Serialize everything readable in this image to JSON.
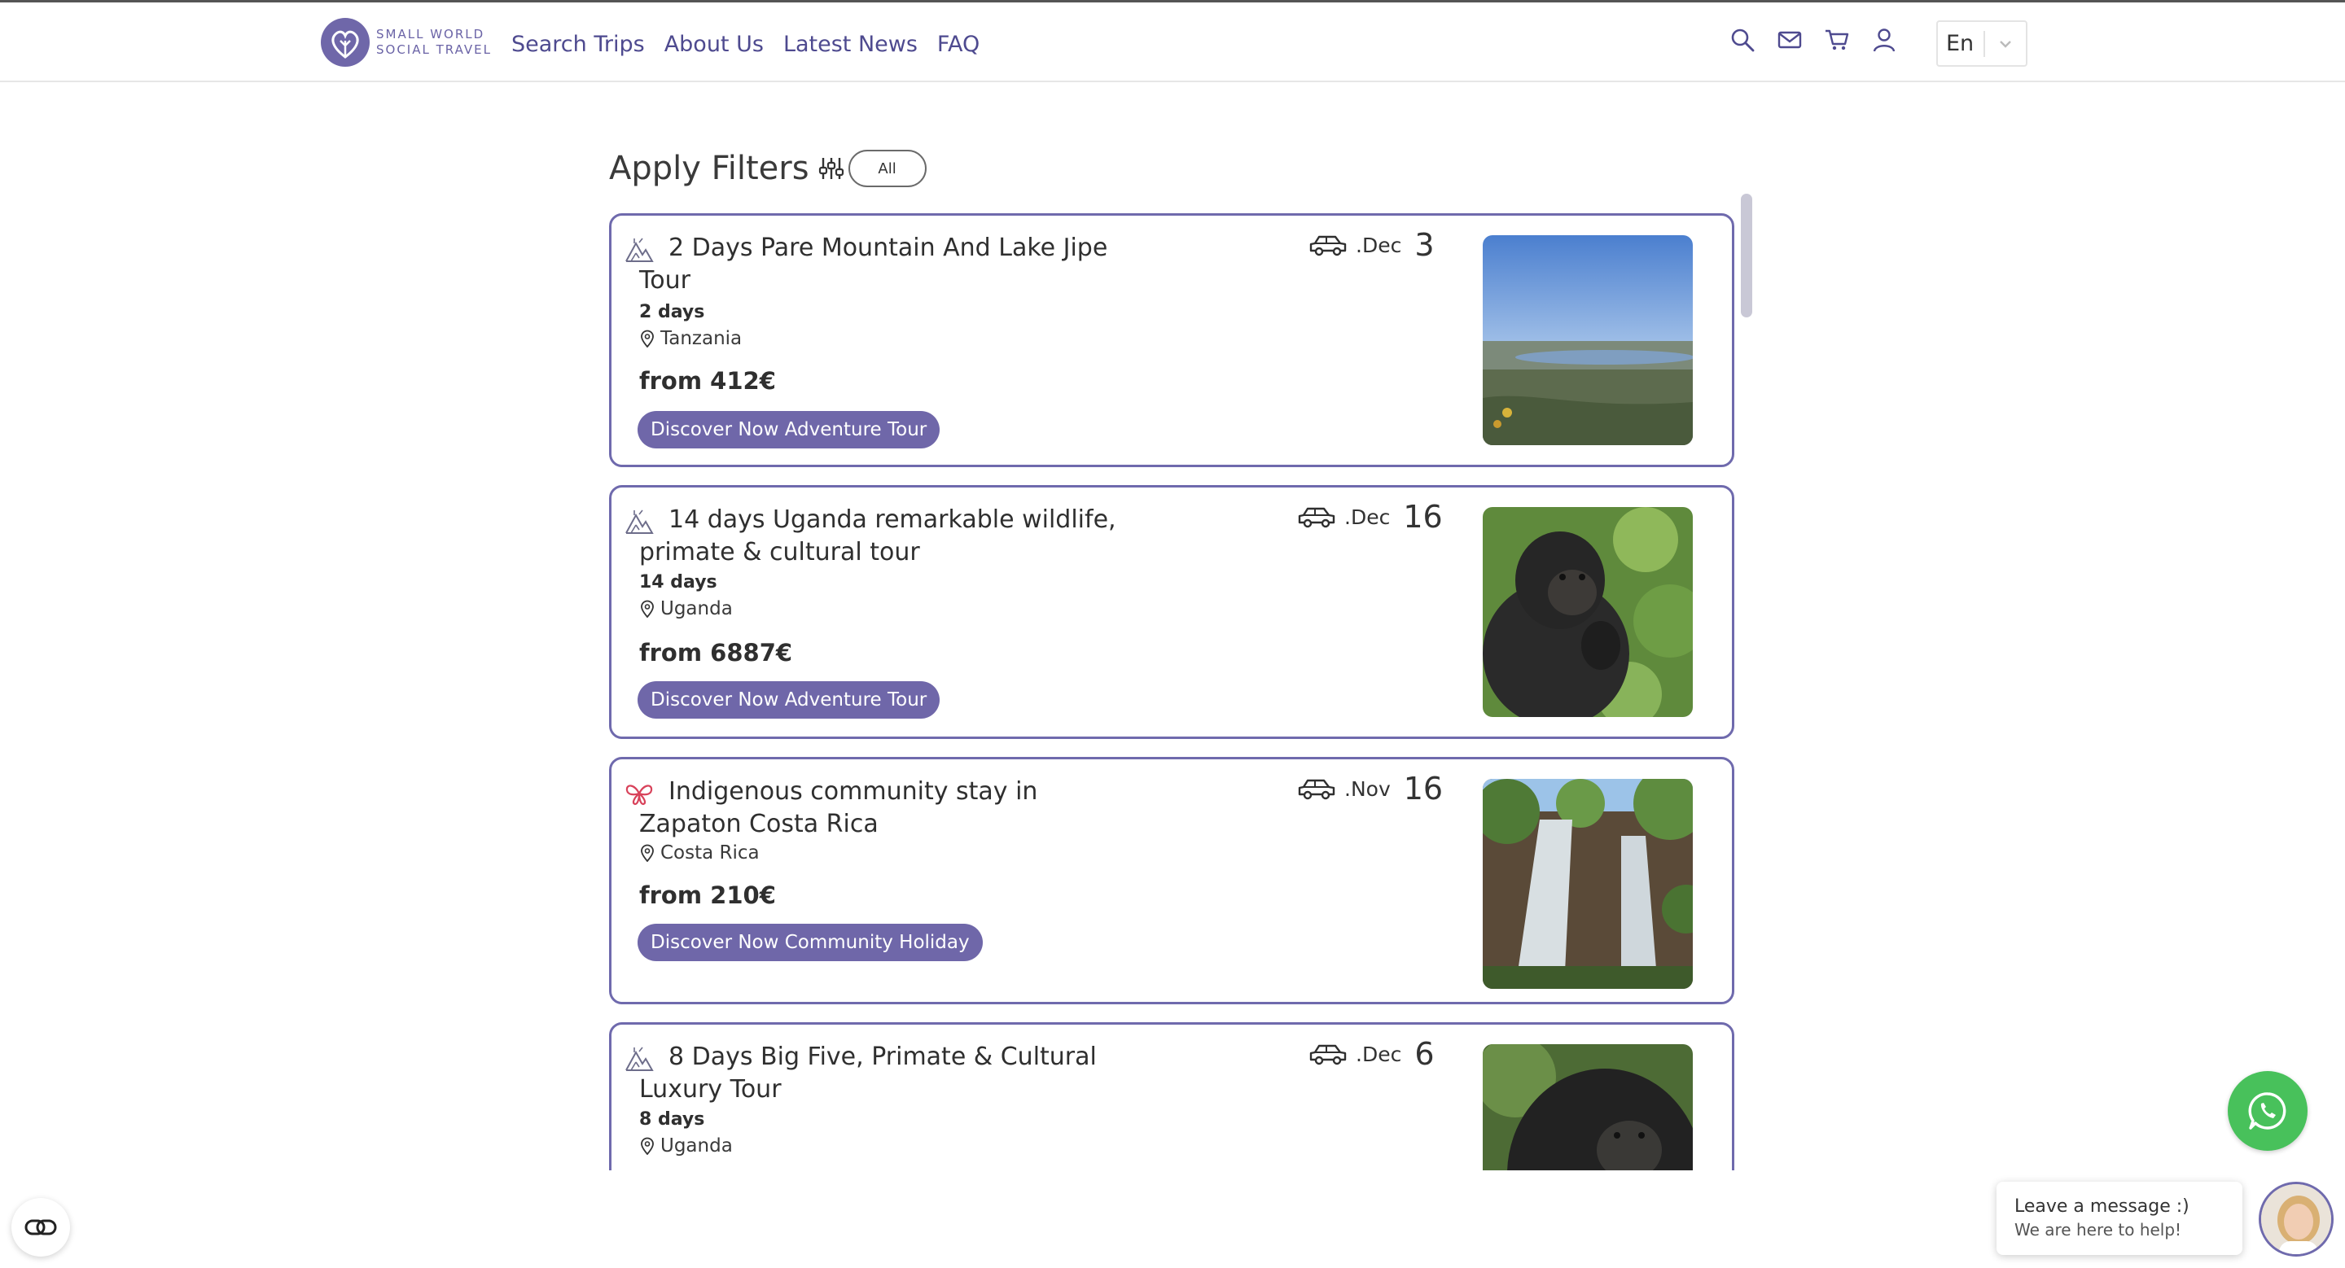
{
  "brand": {
    "line1": "SMALL WORLD",
    "line2": "SOCIAL TRAVEL",
    "accent": "#6f67a9"
  },
  "nav": {
    "items": [
      {
        "label": "Search Trips"
      },
      {
        "label": "About Us"
      },
      {
        "label": "Latest News"
      },
      {
        "label": "FAQ"
      }
    ]
  },
  "header_icons": [
    "search-icon",
    "mail-icon",
    "cart-icon",
    "user-icon"
  ],
  "language": {
    "selected": "En"
  },
  "filters": {
    "title": "Apply Filters",
    "all_label": "All"
  },
  "trips": [
    {
      "title": "2 Days Pare Mountain And Lake Jipe Tour",
      "category_icon": "mountain-icon",
      "duration": "2 days",
      "location": "Tanzania",
      "price": "from 412€",
      "button": "Discover Now Adventure Tour",
      "month": ".Dec",
      "day": "3",
      "image": "lake-landscape"
    },
    {
      "title": "14 days Uganda remarkable wildlife, primate & cultural tour",
      "category_icon": "mountain-icon",
      "duration": "14 days",
      "location": "Uganda",
      "price": "from 6887€",
      "button": "Discover Now Adventure Tour",
      "month": ".Dec",
      "day": "16",
      "image": "baby-gorilla"
    },
    {
      "title": "Indigenous community stay in Zapaton Costa Rica",
      "category_icon": "butterfly-icon",
      "duration": "",
      "location": "Costa Rica",
      "price": "from 210€",
      "button": "Discover Now Community Holiday",
      "month": ".Nov",
      "day": "16",
      "image": "waterfall"
    },
    {
      "title": "8 Days Big Five, Primate & Cultural Luxury Tour",
      "category_icon": "mountain-icon",
      "duration": "8 days",
      "location": "Uganda",
      "price": "",
      "button": "",
      "month": ".Dec",
      "day": "6",
      "image": "gorilla"
    }
  ],
  "chat": {
    "line1": "Leave a message :)",
    "line2": "We are here to help!"
  },
  "colors": {
    "card_border": "#6f6aad",
    "button_bg": "#6f67a9",
    "whatsapp": "#48c15b",
    "nav_text": "#4e4a8f"
  }
}
